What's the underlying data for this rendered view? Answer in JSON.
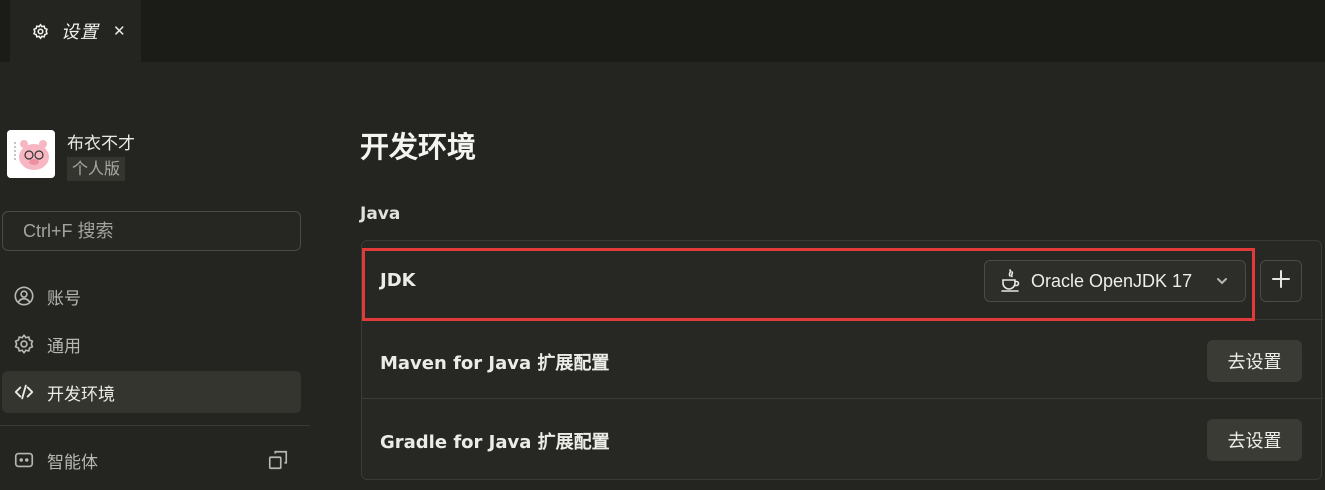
{
  "tab": {
    "title": "设置",
    "close": "✕"
  },
  "user": {
    "name": "布衣不才",
    "edition": "个人版"
  },
  "search": {
    "placeholder": "Ctrl+F 搜索"
  },
  "nav": [
    {
      "label": "账号",
      "icon": "user-circle-icon"
    },
    {
      "label": "通用",
      "icon": "gear-icon"
    },
    {
      "label": "开发环境",
      "icon": "code-icon",
      "active": true
    },
    {
      "label": "智能体",
      "icon": "robot-icon"
    }
  ],
  "main": {
    "title": "开发环境",
    "group": "Java",
    "rows": {
      "jdk": {
        "label": "JDK",
        "selected": "Oracle OpenJDK 17",
        "add": "+"
      },
      "maven": {
        "label": "Maven for Java 扩展配置",
        "button": "去设置"
      },
      "gradle": {
        "label": "Gradle for Java 扩展配置",
        "button": "去设置"
      }
    }
  },
  "colors": {
    "highlight": "#e03a3a",
    "background": "#242520",
    "tabbar": "#1b1b18"
  }
}
